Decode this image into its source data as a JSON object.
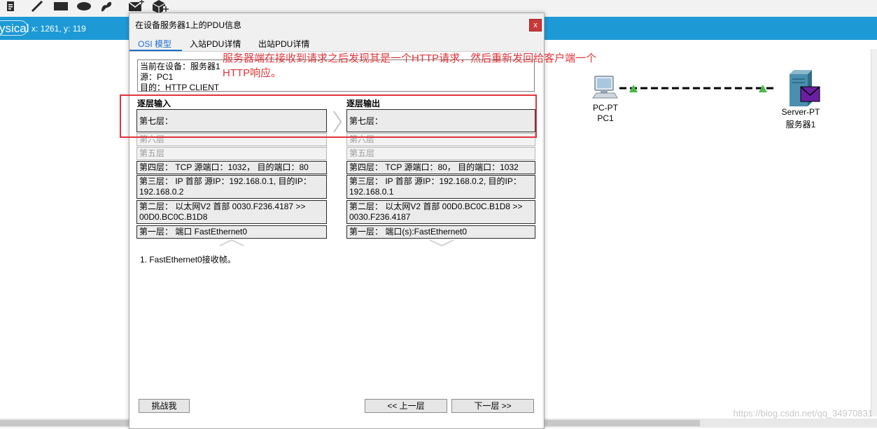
{
  "app": {
    "mode_button": "ysical",
    "coords": "x: 1261, y: 119",
    "toolbar_icons": [
      "note-icon",
      "pencil-icon",
      "rectangle-icon",
      "ellipse-icon",
      "freeform-icon",
      "add-simple-pdu-icon",
      "add-complex-pdu-icon"
    ]
  },
  "topology": {
    "pc_type": "PC-PT",
    "pc_name": "PC1",
    "server_type": "Server-PT",
    "server_name": "服务器1"
  },
  "dialog": {
    "title": "在设备服务器1上的PDU信息",
    "close": "x",
    "tabs": [
      "OSI 模型",
      "入站PDU详情",
      "出站PDU详情"
    ],
    "active_tab": 0,
    "info": {
      "device": "当前在设备：服务器1",
      "src": "源：PC1",
      "dst": "目的：HTTP CLIENT"
    },
    "in_header": "逐层输入",
    "out_header": "逐层输出",
    "in_layers": [
      "第七层：",
      "第六层",
      "第五层",
      "第四层： TCP 源端口：1032， 目的端口：80",
      "第三层： IP 首部 源IP：192.168.0.1, 目的IP：192.168.0.2",
      "第二层： 以太网V2 首部 0030.F236.4187 >> 00D0.BC0C.B1D8",
      "第一层： 端口 FastEthernet0"
    ],
    "out_layers": [
      "第七层：",
      "第六层",
      "第五层",
      "第四层： TCP 源端口：80， 目的端口：1032",
      "第三层： IP 首部 源IP：192.168.0.2, 目的IP：192.168.0.1",
      "第二层： 以太网V2 首部 00D0.BC0C.B1D8 >> 0030.F236.4187",
      "第一层： 端口(s):FastEthernet0"
    ],
    "step_note": "1. FastEthernet0接收帧。",
    "challenge_button": "挑战我",
    "prev_button": "<< 上一层",
    "next_button": "下一层 >>"
  },
  "annotation": {
    "text": "服务器端在接收到请求之后发现其是一个HTTP请求，然后重新发回给客户端一个HTTP响应。",
    "color": "#e0353b"
  },
  "watermark": "https://blog.csdn.net/qq_34970831"
}
